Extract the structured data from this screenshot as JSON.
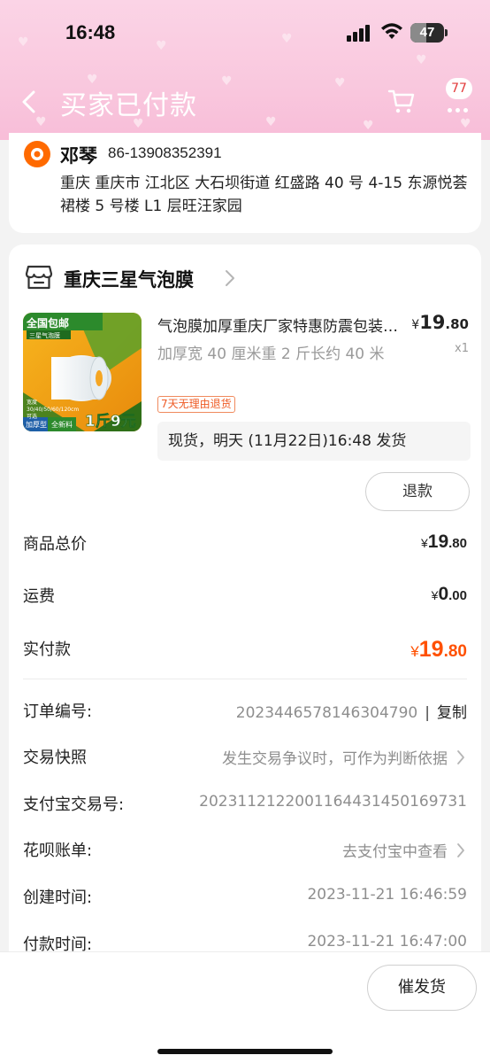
{
  "status_bar": {
    "time": "16:48",
    "battery": "47",
    "battery_level_percent": 47
  },
  "header": {
    "title": "买家已付款",
    "message_badge": "77",
    "icons": [
      "back-chevron-icon",
      "cart-icon",
      "more-icon"
    ]
  },
  "address": {
    "name": "邓琴",
    "phone": "86-13908352391",
    "full_address": "重庆 重庆市 江北区 大石坝街道 红盛路 40 号 4-15 东源悦荟裙楼 5 号楼 L1 层旺汪家园"
  },
  "store": {
    "name": "重庆三星气泡膜"
  },
  "product": {
    "title": "气泡膜加厚重庆厂家特惠防震包装泡沫",
    "spec": "加厚宽 40 厘米重 2 斤长约 40 米",
    "price_currency": "¥",
    "price_int": "19",
    "price_dec": ".80",
    "qty": "x1",
    "return_badge": "7天无理由退货",
    "shipping": "现货，明天 (11月22日)16:48 发货",
    "refund_label": "退款",
    "image": {
      "banner": "全国包邮",
      "sub_banner": "三星气泡膜",
      "sizes": "宽度30/40/50/60/120cm可选",
      "tag1": "加厚型",
      "tag2": "全新料",
      "promo": "1斤9元"
    }
  },
  "summary": {
    "subtotal": {
      "label": "商品总价",
      "currency": "¥",
      "int": "19",
      "dec": ".80"
    },
    "shipping": {
      "label": "运费",
      "currency": "¥",
      "int": "0",
      "dec": ".00"
    },
    "paid": {
      "label": "实付款",
      "currency": "¥",
      "int": "19",
      "dec": ".80",
      "color": "#ff5000"
    }
  },
  "order_info": {
    "order_no": {
      "label": "订单编号:",
      "value": "2023446578146304790",
      "sep": "|",
      "copy": "复制"
    },
    "snapshot": {
      "label": "交易快照",
      "value": "发生交易争议时，可作为判断依据"
    },
    "alipay_no": {
      "label": "支付宝交易号:",
      "value": "2023112122001164431450169731"
    },
    "huabei": {
      "label": "花呗账单:",
      "value": "去支付宝中查看"
    },
    "created": {
      "label": "创建时间:",
      "value": "2023-11-21 16:46:59"
    },
    "paid_time": {
      "label": "付款时间:",
      "value": "2023-11-21 16:47:00"
    }
  },
  "bottom_bar": {
    "urge_label": "催发货"
  },
  "colors": {
    "header_pink": "#f9c8de",
    "accent_orange": "#ff5000",
    "badge_red": "#e23a3a"
  }
}
